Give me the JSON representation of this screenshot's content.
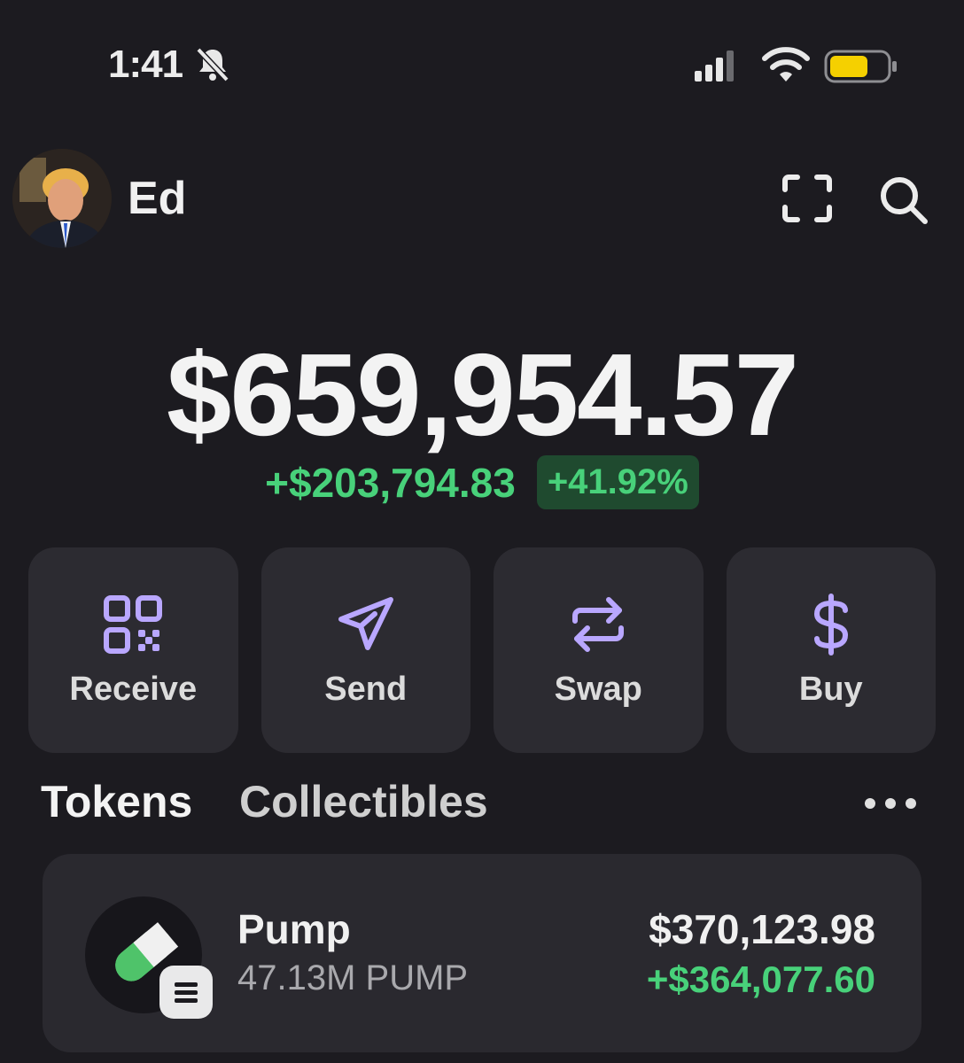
{
  "status_bar": {
    "time": "1:41",
    "icons": [
      "bell-slash-icon",
      "cellular-signal-icon",
      "wifi-icon",
      "battery-icon"
    ],
    "battery_color": "#f5d000"
  },
  "header": {
    "username": "Ed",
    "icons": [
      "avatar",
      "scan-icon",
      "search-icon"
    ]
  },
  "balance": {
    "total": "$659,954.57",
    "change_amount": "+$203,794.83",
    "change_percent": "+41.92%"
  },
  "actions": [
    {
      "label": "Receive",
      "icon": "qr-code-icon"
    },
    {
      "label": "Send",
      "icon": "paper-plane-icon"
    },
    {
      "label": "Swap",
      "icon": "swap-arrows-icon"
    },
    {
      "label": "Buy",
      "icon": "dollar-icon"
    }
  ],
  "tabs": {
    "tokens": "Tokens",
    "collectibles": "Collectibles",
    "more_icon": "more-horizontal-icon"
  },
  "tokens": [
    {
      "name": "Pump",
      "amount": "47.13M PUMP",
      "value": "$370,123.98",
      "change": "+$364,077.60",
      "icon": "pill-icon",
      "chain_icon": "solana-icon"
    }
  ],
  "colors": {
    "background": "#1c1b20",
    "card": "#2c2b31",
    "positive": "#48d17a",
    "positive_bg": "#1f4a2f",
    "accent": "#b9a7ff"
  }
}
